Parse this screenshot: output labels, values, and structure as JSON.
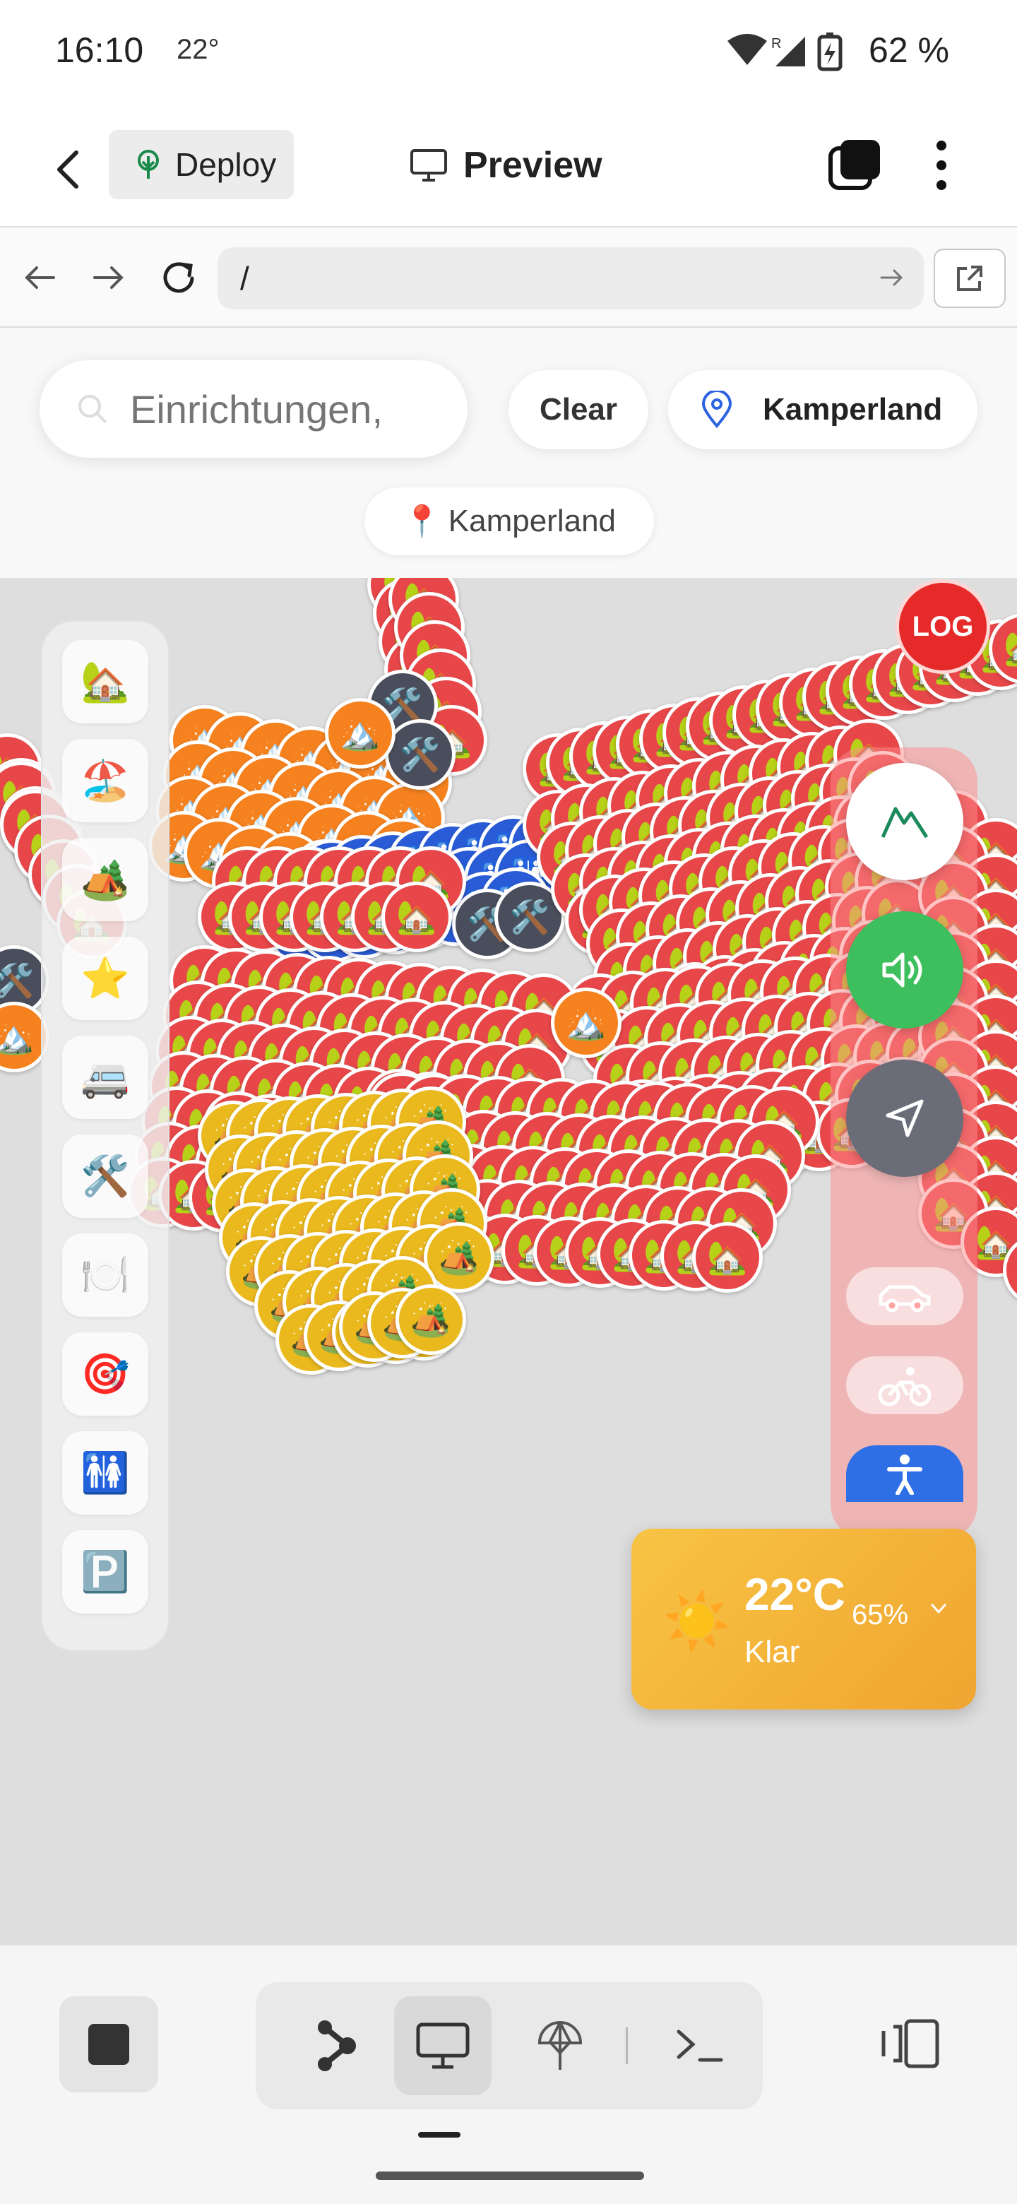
{
  "status_bar": {
    "time": "16:10",
    "temperature": "22°",
    "battery": "62 %",
    "icons": [
      "wifi-icon",
      "signal-icon",
      "battery-charging-icon"
    ]
  },
  "app_bar": {
    "deploy_label": "Deploy",
    "title": "Preview"
  },
  "browser": {
    "url": "/"
  },
  "map": {
    "search_placeholder": "Einrichtungen,",
    "clear_label": "Clear",
    "location_label": "Kamperland",
    "location_chip": "Kamperland",
    "location_chip_icon": "📍",
    "log_label": "LOG",
    "categories": [
      {
        "name": "accommodation",
        "icon": "🏡"
      },
      {
        "name": "beach",
        "icon": "🏖️"
      },
      {
        "name": "camping",
        "icon": "🏕️"
      },
      {
        "name": "favorites",
        "icon": "⭐"
      },
      {
        "name": "camper",
        "icon": "🚐"
      },
      {
        "name": "service",
        "icon": "🛠️"
      },
      {
        "name": "restaurant",
        "icon": "🍽️"
      },
      {
        "name": "activities",
        "icon": "🎯"
      },
      {
        "name": "toilets",
        "icon": "🚻"
      },
      {
        "name": "parking",
        "icon": "🅿️"
      }
    ],
    "controls": {
      "terrain_icon": "mountain-icon",
      "audio_icon": "speaker-icon",
      "navigate_icon": "navigation-arrow-icon",
      "transport_modes": [
        "car-icon",
        "bicycle-icon",
        "walking-icon"
      ]
    },
    "marker_colors": {
      "accommodation": "#e8474a",
      "camping": "#eab91e",
      "beach": "#f5821f",
      "toilets": "#2a5bd6",
      "service": "#4a4e5c"
    }
  },
  "weather": {
    "temperature": "22°C",
    "humidity": "65%",
    "description": "Klar",
    "icon": "☀️"
  },
  "colors": {
    "accent_orange": "#f0a531",
    "log_red": "#e62a2a",
    "audio_green": "#3cbf5c",
    "navigate_gray": "#6a6c78",
    "walking_blue": "#2f6fe6"
  }
}
